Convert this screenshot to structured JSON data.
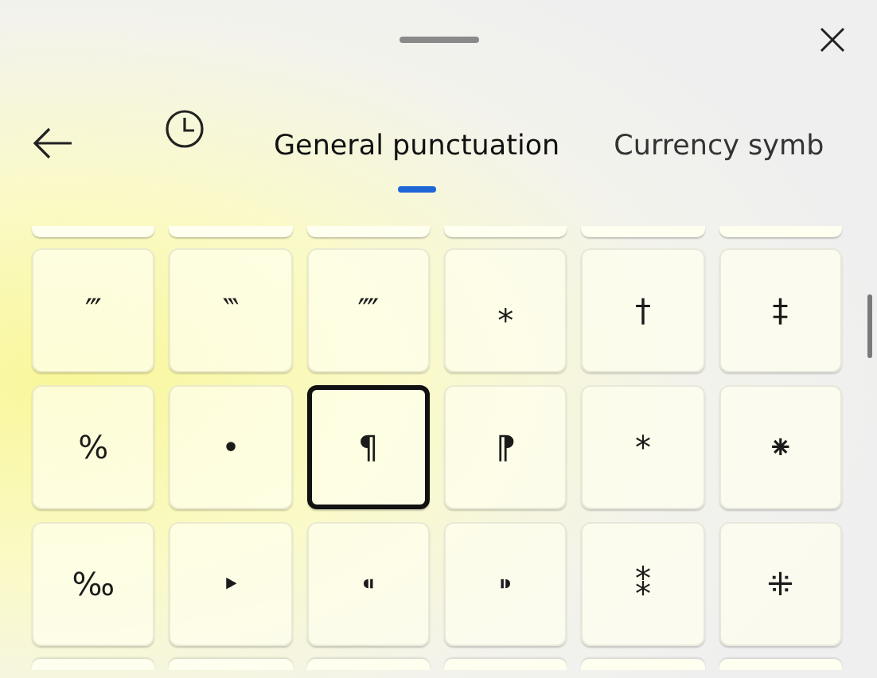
{
  "tabs": [
    {
      "kind": "recent",
      "selected": false
    },
    {
      "kind": "text",
      "label": "General punctuation",
      "selected": true
    },
    {
      "kind": "text",
      "label": "Currency symb",
      "selected": false
    }
  ],
  "symbols": [
    [
      {
        "char": "‴",
        "selected": false
      },
      {
        "char": "‷",
        "selected": false
      },
      {
        "char": "⁗",
        "selected": false
      },
      {
        "char": "⁎",
        "selected": false
      },
      {
        "char": "†",
        "selected": false
      },
      {
        "char": "‡",
        "selected": false
      }
    ],
    [
      {
        "char": "%",
        "selected": false
      },
      {
        "char": "•",
        "selected": false
      },
      {
        "char": "¶",
        "selected": true
      },
      {
        "char": "⁋",
        "selected": false
      },
      {
        "char": "*",
        "selected": false
      },
      {
        "char": "⁕",
        "selected": false
      }
    ],
    [
      {
        "char": "‰",
        "selected": false
      },
      {
        "char": "‣",
        "selected": false
      },
      {
        "char": "⁌",
        "selected": false
      },
      {
        "char": "⁍",
        "selected": false
      },
      {
        "char": "⁑",
        "selected": false
      },
      {
        "char": "⁜",
        "selected": false
      }
    ]
  ]
}
